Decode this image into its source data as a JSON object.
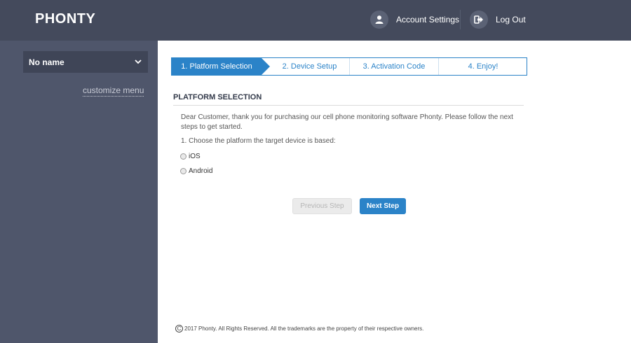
{
  "header": {
    "logo": "PHONTY",
    "account_settings_label": "Account Settings",
    "logout_label": "Log Out",
    "icons": {
      "account": "user-icon",
      "logout": "logout-icon"
    }
  },
  "sidebar": {
    "device_name": "No name",
    "customize_label": "customize menu"
  },
  "steps": [
    {
      "label": "1. Platform Selection",
      "active": true
    },
    {
      "label": "2. Device Setup",
      "active": false
    },
    {
      "label": "3. Activation Code",
      "active": false
    },
    {
      "label": "4. Enjoy!",
      "active": false
    }
  ],
  "content": {
    "section_title": "PLATFORM SELECTION",
    "intro": "Dear Customer, thank you for purchasing our cell phone monitoring software Phonty. Please follow the next steps to get started.",
    "question": "1. Choose the platform the target device is based:",
    "options": [
      {
        "label": "iOS",
        "selected": false
      },
      {
        "label": "Android",
        "selected": false
      }
    ],
    "prev_label": "Previous Step",
    "next_label": "Next Step"
  },
  "footer": {
    "copyright_symbol": "C",
    "text": "2017 Phonty. All Rights Reserved. All the trademarks are the property of their respective owners."
  },
  "colors": {
    "header_bg": "#444a5c",
    "sidebar_bg": "#4f566b",
    "accent": "#2b83c8"
  }
}
